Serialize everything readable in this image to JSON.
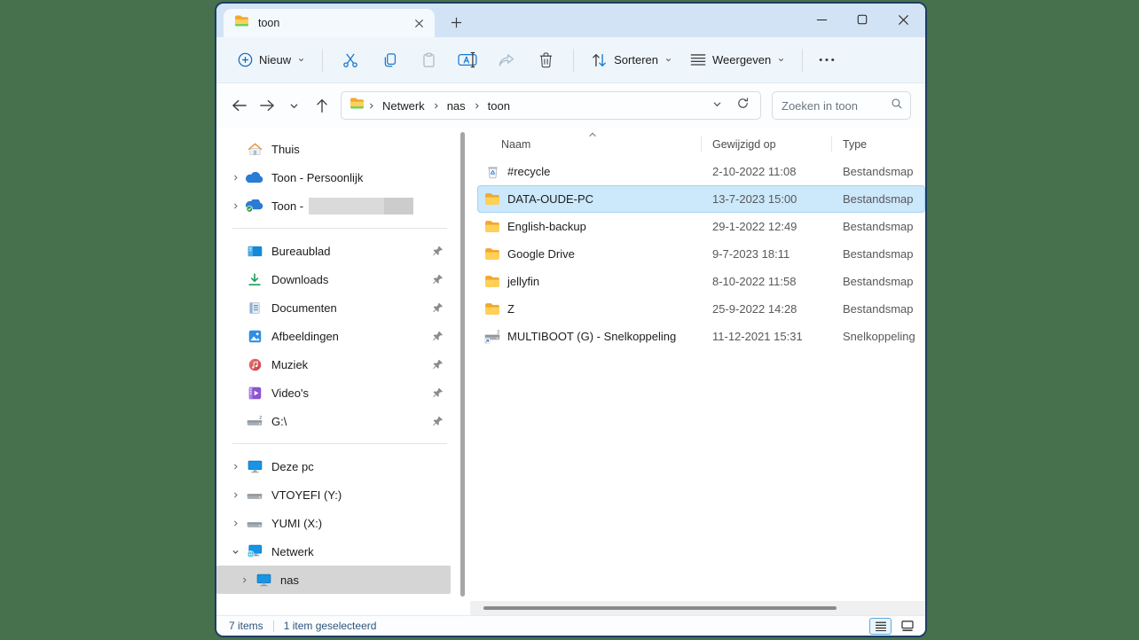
{
  "window": {
    "tab_title": "toon"
  },
  "toolbar": {
    "new_label": "Nieuw",
    "sort_label": "Sorteren",
    "view_label": "Weergeven",
    "icons": [
      "cut-icon",
      "copy-icon",
      "paste-icon",
      "rename-icon",
      "share-icon",
      "delete-icon",
      "more-icon"
    ]
  },
  "address": {
    "crumbs": [
      "Netwerk",
      "nas",
      "toon"
    ],
    "search_placeholder": "Zoeken in toon"
  },
  "sidebar": {
    "top": [
      {
        "label": "Thuis",
        "icon": "home-icon"
      },
      {
        "label": "Toon - Persoonlijk",
        "icon": "onedrive-icon"
      },
      {
        "label": "Toon -",
        "icon": "onedrive-synced-icon",
        "redacted": true
      }
    ],
    "pinned": [
      {
        "label": "Bureaublad",
        "icon": "desktop-icon"
      },
      {
        "label": "Downloads",
        "icon": "downloads-icon"
      },
      {
        "label": "Documenten",
        "icon": "documents-icon"
      },
      {
        "label": "Afbeeldingen",
        "icon": "pictures-icon"
      },
      {
        "label": "Muziek",
        "icon": "music-icon"
      },
      {
        "label": "Video's",
        "icon": "videos-icon"
      },
      {
        "label": "G:\\",
        "icon": "drive-icon"
      }
    ],
    "tree": [
      {
        "label": "Deze pc",
        "icon": "pc-icon"
      },
      {
        "label": "VTOYEFI (Y:)",
        "icon": "drive-icon"
      },
      {
        "label": "YUMI (X:)",
        "icon": "drive-icon"
      },
      {
        "label": "Netwerk",
        "icon": "network-icon",
        "expanded": true
      },
      {
        "label": "nas",
        "icon": "pc-icon",
        "selected": true
      }
    ]
  },
  "files": {
    "columns": [
      "Naam",
      "Gewijzigd op",
      "Type"
    ],
    "sorted_by": "Naam",
    "sort_direction": "ascending",
    "rows": [
      {
        "name": "#recycle",
        "modified": "2-10-2022 11:08",
        "type": "Bestandsmap",
        "icon": "recycle-bin-icon",
        "selected": false
      },
      {
        "name": "DATA-OUDE-PC",
        "modified": "13-7-2023 15:00",
        "type": "Bestandsmap",
        "icon": "folder-icon",
        "selected": true
      },
      {
        "name": "English-backup",
        "modified": "29-1-2022 12:49",
        "type": "Bestandsmap",
        "icon": "folder-icon",
        "selected": false
      },
      {
        "name": "Google Drive",
        "modified": "9-7-2023 18:11",
        "type": "Bestandsmap",
        "icon": "folder-icon",
        "selected": false
      },
      {
        "name": "jellyfin",
        "modified": "8-10-2022 11:58",
        "type": "Bestandsmap",
        "icon": "folder-icon",
        "selected": false
      },
      {
        "name": "Z",
        "modified": "25-9-2022 14:28",
        "type": "Bestandsmap",
        "icon": "folder-icon",
        "selected": false
      },
      {
        "name": "MULTIBOOT (G) - Snelkoppeling",
        "modified": "11-12-2021 15:31",
        "type": "Snelkoppeling",
        "icon": "drive-shortcut-icon",
        "selected": false
      }
    ]
  },
  "statusbar": {
    "count": "7 items",
    "selection": "1 item geselecteerd"
  },
  "colors": {
    "desktop_background": "#47704c",
    "window_border": "#1a3e63",
    "titlebar": "#d2e3f5",
    "toolbar": "#eef6fc",
    "selection_blue": "#cce8fb",
    "sidebar_selection": "#d5d5d5",
    "accent_blue": "#1b78cc"
  }
}
